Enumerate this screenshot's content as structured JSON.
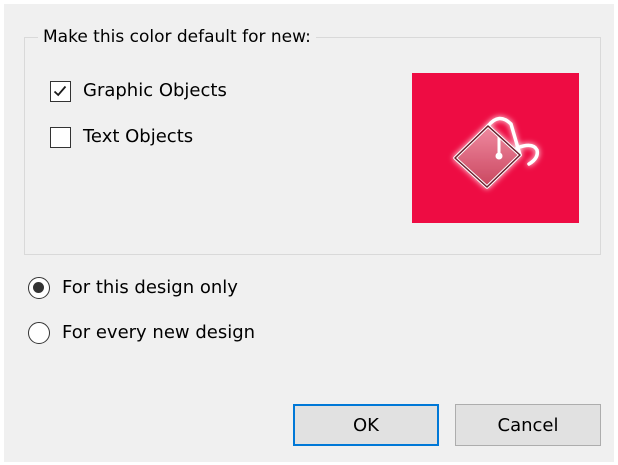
{
  "dialog": {
    "group_label": "Make this color default for new:",
    "checkboxes": [
      {
        "label": "Graphic Objects",
        "checked": true
      },
      {
        "label": "Text Objects",
        "checked": false
      }
    ],
    "preview": {
      "icon": "paint-bucket-icon",
      "background_color": "#ee0c43"
    },
    "scope_options": [
      {
        "label": "For this design only",
        "selected": true
      },
      {
        "label": "For every new design",
        "selected": false
      }
    ],
    "buttons": {
      "ok_label": "OK",
      "cancel_label": "Cancel"
    }
  },
  "colors": {
    "dialog_background": "#f0f0f0",
    "default_button_border": "#0078d7",
    "button_face": "#e1e1e1"
  }
}
